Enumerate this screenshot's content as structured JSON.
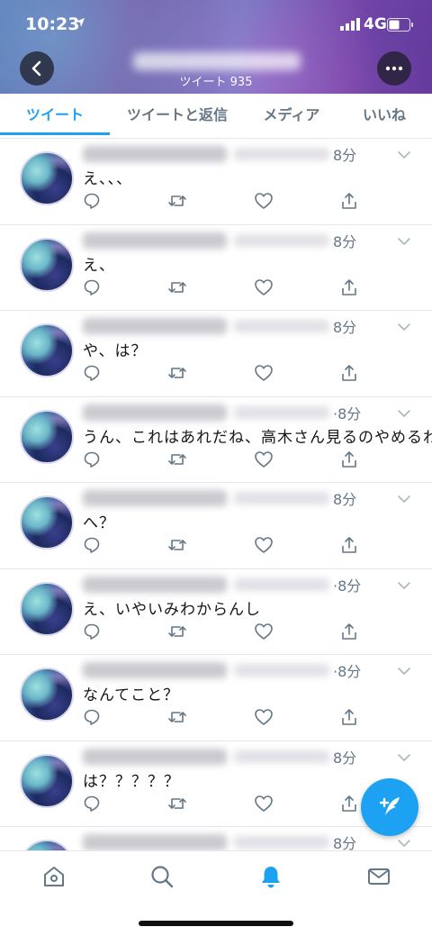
{
  "status_bar": {
    "time": "10:23",
    "network": "4G"
  },
  "header": {
    "tweet_count": "ツイート 935"
  },
  "tabs": [
    {
      "label": "ツイート",
      "active": true
    },
    {
      "label": "ツイートと返信",
      "active": false
    },
    {
      "label": "メディア",
      "active": false
    },
    {
      "label": "いいね",
      "active": false
    }
  ],
  "tweets": [
    {
      "time": "8分",
      "text": "え、、、"
    },
    {
      "time": "8分",
      "text": "え、"
    },
    {
      "time": "8分",
      "text": "や、は？"
    },
    {
      "time": "·8分",
      "text": "うん、これはあれだね、高木さん見るのやめるわ"
    },
    {
      "time": "8分",
      "text": "へ？"
    },
    {
      "time": "·8分",
      "text": "え、いやいみわからんし"
    },
    {
      "time": "·8分",
      "text": "なんてこと？"
    },
    {
      "time": "8分",
      "text": "は？？？？？"
    },
    {
      "time": "8分",
      "text": ""
    }
  ],
  "colors": {
    "accent": "#1da1f2",
    "secondary_text": "#657786",
    "divider": "#e1e8ed"
  },
  "icons": {
    "reply": "reply-icon",
    "retweet": "retweet-icon",
    "like": "heart-icon",
    "share": "share-icon",
    "compose": "compose-tweet-icon",
    "nav": [
      "home-icon",
      "search-icon",
      "notifications-bell-icon",
      "messages-envelope-icon"
    ]
  },
  "bottom_nav": {
    "active": "notifications"
  }
}
